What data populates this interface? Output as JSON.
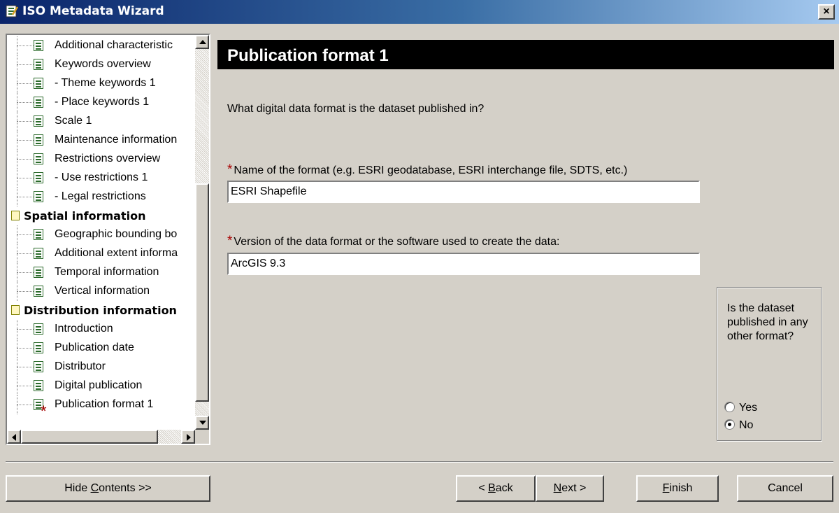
{
  "window": {
    "title": "ISO Metadata Wizard",
    "close_glyph": "×"
  },
  "tree": {
    "items": [
      {
        "label": "Additional characteristic",
        "type": "doc"
      },
      {
        "label": "Keywords overview",
        "type": "doc"
      },
      {
        "label": "- Theme keywords 1",
        "type": "doc"
      },
      {
        "label": "- Place keywords 1",
        "type": "doc"
      },
      {
        "label": "Scale 1",
        "type": "doc"
      },
      {
        "label": "Maintenance information",
        "type": "doc"
      },
      {
        "label": "Restrictions overview",
        "type": "doc"
      },
      {
        "label": "- Use restrictions 1",
        "type": "doc"
      },
      {
        "label": "- Legal restrictions",
        "type": "doc"
      },
      {
        "label": "Spatial information",
        "type": "section"
      },
      {
        "label": "Geographic bounding bo",
        "type": "doc"
      },
      {
        "label": "Additional extent informa",
        "type": "doc"
      },
      {
        "label": "Temporal information",
        "type": "doc"
      },
      {
        "label": "Vertical information",
        "type": "doc"
      },
      {
        "label": "Distribution information",
        "type": "section"
      },
      {
        "label": "Introduction",
        "type": "doc"
      },
      {
        "label": "Publication date",
        "type": "doc"
      },
      {
        "label": "Distributor",
        "type": "doc"
      },
      {
        "label": "Digital publication",
        "type": "doc"
      },
      {
        "label": "Publication format 1",
        "type": "doc",
        "selected": true,
        "required": true
      }
    ],
    "required_marker": "*"
  },
  "main": {
    "title": "Publication format 1",
    "question": "What digital data format is the dataset published in?",
    "format_name": {
      "required_marker": "*",
      "label": "Name of the format (e.g. ESRI geodatabase, ESRI interchange file, SDTS, etc.)",
      "value": "ESRI Shapefile"
    },
    "format_version": {
      "required_marker": "*",
      "label": "Version of the data format or the software used to create the data:",
      "value": "ArcGIS 9.3"
    },
    "other_format": {
      "question": "Is the dataset published in any other format?",
      "options": [
        {
          "label": "Yes",
          "selected": false
        },
        {
          "label": "No",
          "selected": true
        }
      ]
    }
  },
  "buttons": {
    "hide_contents": {
      "pre": "Hide ",
      "key": "C",
      "post": "ontents >>"
    },
    "back": {
      "pre": "< ",
      "key": "B",
      "post": "ack"
    },
    "next": {
      "pre": "",
      "key": "N",
      "post": "ext >"
    },
    "finish": {
      "pre": "",
      "key": "F",
      "post": "inish"
    },
    "cancel": {
      "label": "Cancel"
    }
  },
  "colors": {
    "titlebar_start": "#0a246a",
    "required_star": "#a80000",
    "title_band": "#000000"
  }
}
